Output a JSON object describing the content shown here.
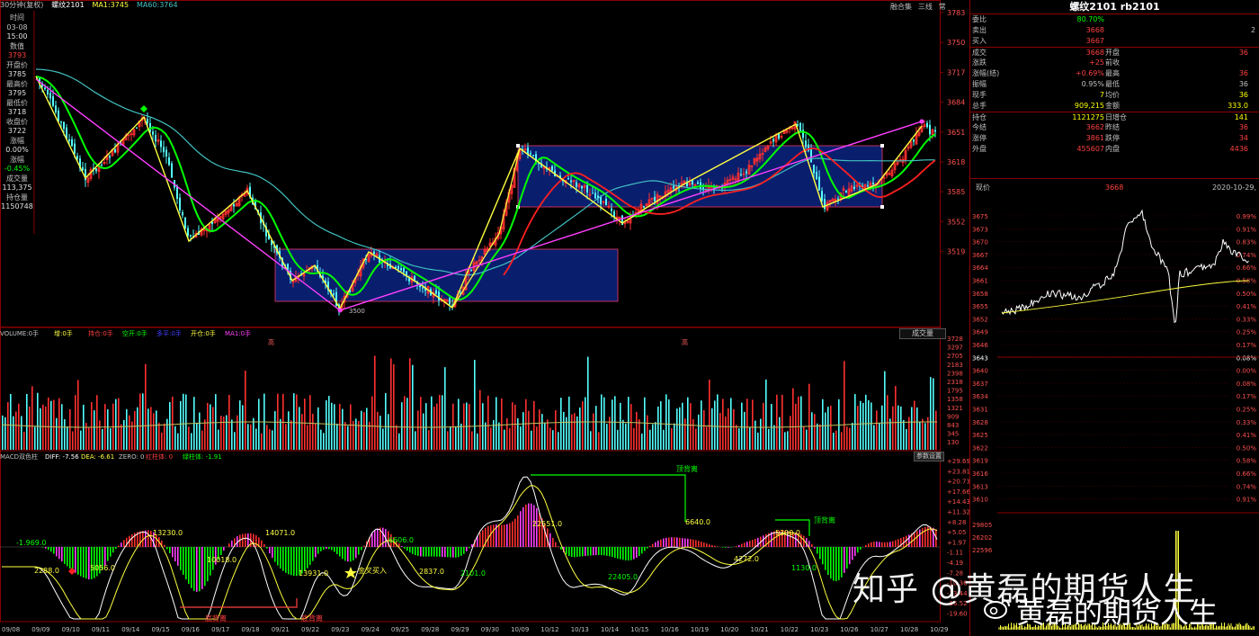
{
  "kline": {
    "header": {
      "period": "30分钟(复权)",
      "symbol": "螺纹2101",
      "ma1": "MA1:3745",
      "ma60": "MA60:3764",
      "buttons": [
        "融合集",
        "三线",
        "常"
      ]
    },
    "left_info": [
      {
        "label": "时间",
        "value": ""
      },
      {
        "label": "03-08",
        "value": "15:00"
      },
      {
        "label": "数值",
        "value": "3793"
      },
      {
        "label": "开盘价",
        "value": "3785"
      },
      {
        "label": "最高价",
        "value": "3795"
      },
      {
        "label": "最低价",
        "value": "3718"
      },
      {
        "label": "收盘价",
        "value": "3722"
      },
      {
        "label": "涨幅",
        "value": "0.00%"
      },
      {
        "label": "涨幅",
        "value": "-0.45%"
      },
      {
        "label": "成交量",
        "value": "113,375"
      },
      {
        "label": "持仓量",
        "value": "1150748"
      }
    ],
    "price_axis": [
      "3783",
      "3750",
      "3717",
      "3684",
      "3651",
      "3618",
      "3585",
      "3552",
      "3519"
    ],
    "low_marker": "3500",
    "volume_header": {
      "volume": "VOLUME:0手",
      "items": [
        "增:0手",
        "持仓:0手",
        "空开:0手",
        "多平:0手",
        "开仓:0手",
        "MA1:0手"
      ]
    },
    "volume_axis": [
      "3728",
      "3297",
      "2705",
      "2183",
      "2398",
      "2318",
      "1795",
      "1358",
      "1321",
      "909",
      "843",
      "345",
      "130"
    ],
    "volume_scroll_label": "成交量",
    "macd_header": {
      "title": "MACD双色柱",
      "diff": "DIFF: -7.56",
      "dea": "DEA: -6.61",
      "zero": "ZERO: 0",
      "red": "红柱体: 0",
      "green": "绿柱体: -1.91"
    },
    "macd_btn": "参数设置",
    "macd_axis": [
      "+29.69",
      "+23.81",
      "+20.73",
      "+17.66",
      "+14.43",
      "+11.32",
      "+8.28",
      "+5.05",
      "+1.97",
      "-1.11",
      "-4.19",
      "-7.28",
      "-10.36",
      "-13.44",
      "-16.52",
      "-19.60"
    ],
    "macd_labels": [
      {
        "text": "-1.969.0",
        "id": "m1"
      },
      {
        "text": "13230.0",
        "id": "m2"
      },
      {
        "text": "14071.0",
        "id": "m3"
      },
      {
        "text": "5056.0",
        "id": "m4"
      },
      {
        "text": "2288.0",
        "id": "m5"
      },
      {
        "text": "10018.0",
        "id": "m6"
      },
      {
        "text": "13931.0",
        "id": "m7"
      },
      {
        "text": "6606.0",
        "id": "m8"
      },
      {
        "text": "2837.0",
        "id": "m9"
      },
      {
        "text": "2101.0",
        "id": "m10"
      },
      {
        "text": "22551.0",
        "id": "m11"
      },
      {
        "text": "22405.0",
        "id": "m12"
      },
      {
        "text": "6640.0",
        "id": "m13"
      },
      {
        "text": "4272.0",
        "id": "m14"
      },
      {
        "text": "1130.0",
        "id": "m15"
      },
      {
        "text": "5300.0",
        "id": "m16"
      }
    ],
    "macd_signals": {
      "deviation_top_1": "顶背离",
      "deviation_top_2": "顶背离",
      "deviation_bottom_1": "底背离",
      "deviation_bottom_2": "底背离",
      "golden_cross": "金叉买入"
    },
    "date_axis": [
      "09/08",
      "09/09",
      "09/10",
      "09/11",
      "09/14",
      "09/15",
      "09/16",
      "09/17",
      "09/18",
      "09/21",
      "09/22",
      "09/23",
      "09/24",
      "09/25",
      "09/28",
      "09/29",
      "09/30",
      "10/09",
      "10/12",
      "10/13",
      "10/14",
      "10/15",
      "10/16",
      "10/19",
      "10/20",
      "10/21",
      "10/22",
      "10/23",
      "10/26",
      "10/27",
      "10/28",
      "10/29"
    ],
    "volume_marker": "高"
  },
  "quote": {
    "title": "螺纹2101 rb2101",
    "rows": [
      {
        "label": "委比",
        "value": "80.70%",
        "label2": "",
        "value2": "",
        "extra": "",
        "color": "#00ff00"
      },
      {
        "label": "卖出",
        "value": "3668",
        "label2": "",
        "value2": "",
        "extra": "2",
        "color": "#ff4040"
      },
      {
        "label": "买入",
        "value": "3667",
        "label2": "",
        "value2": "",
        "extra": "",
        "color": "#ff4040"
      },
      {
        "label": "成交",
        "value": "3668",
        "label2": "开盘",
        "value2": "36",
        "extra": "",
        "color": "#ff4040"
      },
      {
        "label": "涨跌",
        "value": "+25",
        "label2": "前收",
        "value2": "",
        "extra": "",
        "color": "#ff4040"
      },
      {
        "label": "涨幅(结)",
        "value": "+0.69%",
        "label2": "最高",
        "value2": "36",
        "extra": "",
        "color": "#ff4040"
      },
      {
        "label": "振幅",
        "value": "0.95%",
        "label2": "最低",
        "value2": "36",
        "extra": "",
        "color": "#c0c0c0"
      },
      {
        "label": "现手",
        "value": "7",
        "label2": "均价",
        "value2": "36",
        "extra": "",
        "color": "#ffff00"
      },
      {
        "label": "总手",
        "value": "909,215",
        "label2": "金额",
        "value2": "333.0",
        "extra": "",
        "color": "#ffff00"
      },
      {
        "label": "持仓",
        "value": "1121275",
        "label2": "日增仓",
        "value2": "141",
        "extra": "",
        "color": "#ffff00"
      },
      {
        "label": "今结",
        "value": "3662",
        "label2": "昨结",
        "value2": "36",
        "extra": "",
        "color": "#ff4040"
      },
      {
        "label": "涨停",
        "value": "3861",
        "label2": "跌停",
        "value2": "34",
        "extra": "",
        "color": "#ff4040"
      },
      {
        "label": "外盘",
        "value": "455607",
        "label2": "内盘",
        "value2": "4436",
        "extra": "",
        "color": "#ff4040"
      }
    ],
    "tick_head": {
      "label": "现价",
      "price": "3668",
      "date": "2020-10-29,"
    },
    "tick_price_axis": [
      "3675",
      "3673",
      "3670",
      "3667",
      "3664",
      "3661",
      "3658",
      "3655",
      "3652",
      "3649",
      "3646",
      "3643",
      "3640",
      "3637",
      "3634",
      "3631",
      "3628",
      "3625",
      "3622",
      "3619",
      "3616",
      "3613",
      "3610"
    ],
    "tick_pct_axis": [
      "0.99%",
      "0.91%",
      "0.83%",
      "0.74%",
      "0.66%",
      "0.58%",
      "0.50%",
      "0.41%",
      "0.33%",
      "0.25%",
      "0.17%",
      "0.08%",
      "0.00%",
      "0.08%",
      "0.17%",
      "0.25%",
      "0.33%",
      "0.41%",
      "0.50%",
      "0.58%",
      "0.66%",
      "0.74%",
      "0.91%"
    ],
    "tick_vol_axis": [
      "29805",
      "26202",
      "22596"
    ]
  },
  "watermark": {
    "zhihu": "知乎 @黄磊的期货人生",
    "weibo": "黄磊的期货人生"
  },
  "colors": {
    "up": "#ff3030",
    "down": "#54ffff",
    "ma_yellow": "#ffff40",
    "ma_green": "#00ff00",
    "ma_cyan": "#40c0c0",
    "ma_red": "#ff2020",
    "trend_magenta": "#ff40ff",
    "box_fill": "#0a1e6e",
    "grid_red": "#8b0000"
  }
}
